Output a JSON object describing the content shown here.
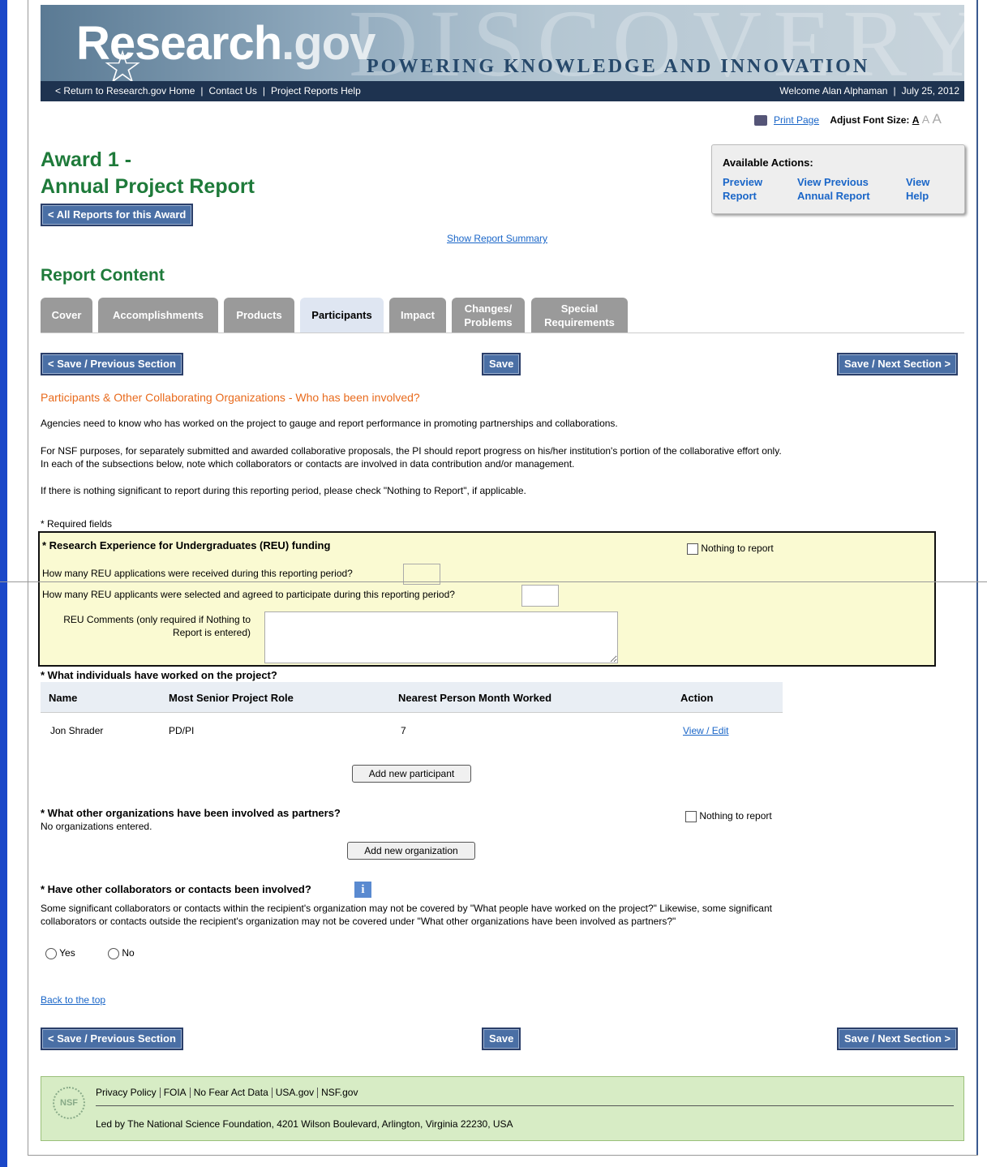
{
  "header": {
    "logo_main": "Research",
    "logo_suffix": ".gov",
    "watermark": "DISCOVERY",
    "tagline": "POWERING KNOWLEDGE AND INNOVATION",
    "nav_links": [
      "< Return to Research.gov Home",
      "Contact Us",
      "Project Reports Help"
    ],
    "welcome": "Welcome Alan Alphaman",
    "date": "July 25, 2012"
  },
  "tools": {
    "print": "Print Page",
    "font_size_label": "Adjust Font Size:",
    "font_a": "A"
  },
  "page": {
    "title_line1": "Award 1 -",
    "title_line2": "Annual Project Report",
    "all_reports_button": "< All Reports for this Award",
    "show_summary": "Show Report Summary",
    "report_content": "Report Content"
  },
  "actions": {
    "heading": "Available Actions:",
    "preview": [
      "Preview",
      "Report"
    ],
    "view_previous": [
      "View Previous",
      "Annual Report"
    ],
    "view_help": [
      "View",
      "Help"
    ]
  },
  "tabs": [
    {
      "label": "Cover"
    },
    {
      "label": "Accomplishments"
    },
    {
      "label": "Products"
    },
    {
      "label": "Participants",
      "active": true
    },
    {
      "label": "Impact"
    },
    {
      "label": "Changes/ Problems"
    },
    {
      "label": "Special Requirements"
    }
  ],
  "nav_buttons": {
    "prev": "< Save / Previous Section",
    "save": "Save",
    "next": "Save / Next Section >"
  },
  "section": {
    "heading": "Participants & Other Collaborating Organizations - Who has been involved?",
    "para1": "Agencies need to know who has worked on the project to gauge and report performance in promoting partnerships and collaborations.",
    "para2a": "For NSF purposes, for separately submitted and awarded collaborative proposals, the PI should report progress on his/her institution's portion of the collaborative effort only.",
    "para2b": "In each of the subsections below, note which collaborators or contacts are involved in data contribution and/or management.",
    "para3": "If there is nothing significant to report during this reporting period, please check \"Nothing to Report\", if applicable.",
    "required": "* Required fields"
  },
  "reu": {
    "heading": "* Research Experience for Undergraduates (REU) funding",
    "nothing": "Nothing to report",
    "q1": "How many REU applications were received during this reporting period?",
    "q1_value": "",
    "q2": "How many REU applicants were selected and agreed to participate during this reporting period?",
    "q2_value": "",
    "comments_label": "REU Comments (only required if Nothing to Report is entered)",
    "comments_value": ""
  },
  "individuals": {
    "heading": "* What individuals have worked on the project?",
    "columns": [
      "Name",
      "Most Senior Project Role",
      "Nearest Person Month Worked",
      "Action"
    ],
    "rows": [
      {
        "name": "Jon Shrader",
        "role": "PD/PI",
        "months": "7",
        "action": "View / Edit"
      }
    ],
    "add_button": "Add new participant"
  },
  "organizations": {
    "heading": "* What other organizations have been involved as partners?",
    "nothing": "Nothing to report",
    "empty": "No organizations entered.",
    "add_button": "Add new organization"
  },
  "collaborators": {
    "heading": "* Have other collaborators or contacts been involved?",
    "text": "Some significant collaborators or contacts within the recipient's organization may not be covered by \"What people have worked on the project?\" Likewise, some significant collaborators or contacts outside the recipient's organization may not be covered under \"What other organizations have been involved as partners?\"",
    "yes": "Yes",
    "no": "No"
  },
  "back_to_top": "Back to the top",
  "footer": {
    "seal": "NSF",
    "links": [
      "Privacy Policy",
      "FOIA",
      "No Fear Act Data",
      "USA.gov",
      "NSF.gov"
    ],
    "address": "Led by The National Science Foundation, 4201 Wilson Boulevard, Arlington, Virginia 22230, USA"
  }
}
